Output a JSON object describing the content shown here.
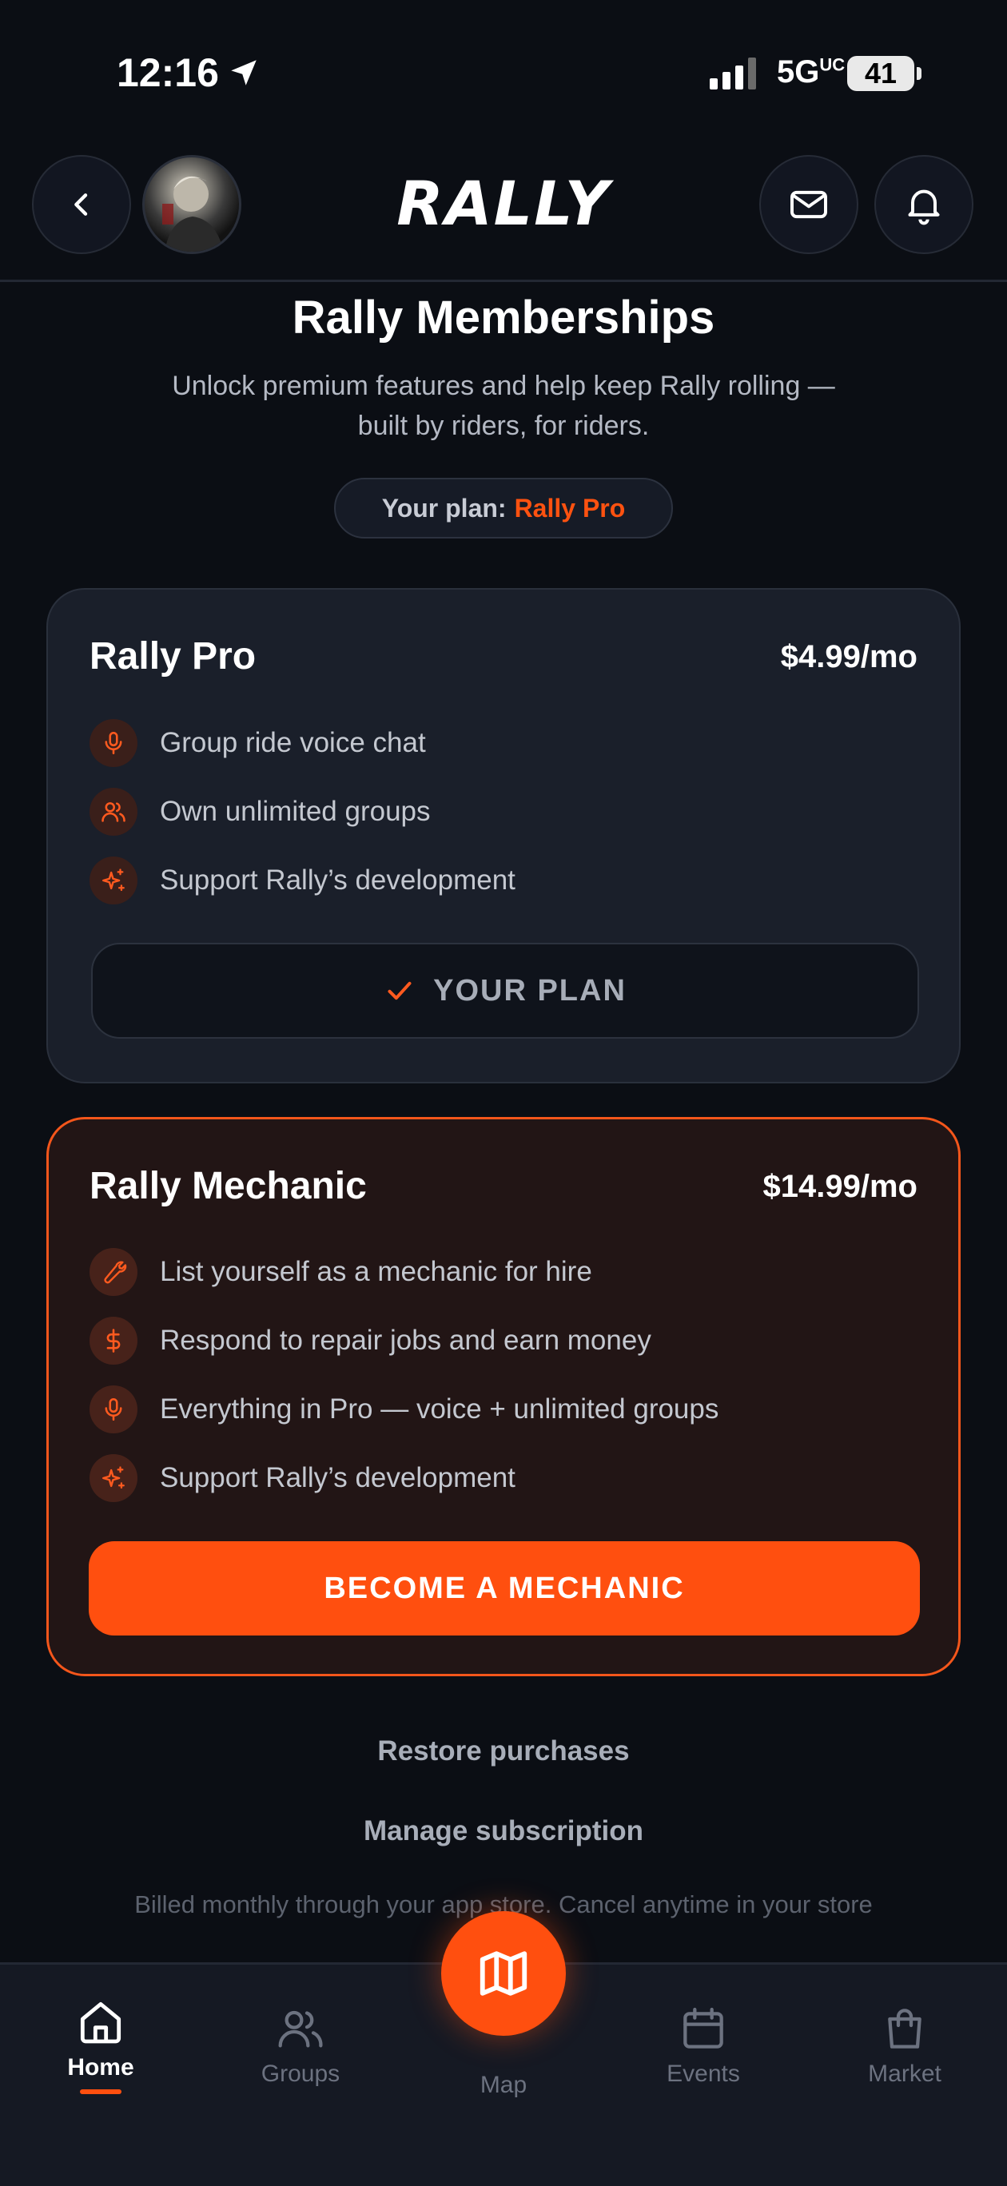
{
  "status_bar": {
    "time": "12:16",
    "network": "5G",
    "network_suffix": "UC",
    "battery": "41"
  },
  "header": {
    "logo_text": "RALLY"
  },
  "hero": {
    "title": "Rally Memberships",
    "subtitle_line1": "Unlock premium features and help keep Rally rolling —",
    "subtitle_line2": "built by riders, for riders.",
    "plan_prefix": "Your plan:",
    "plan_name": "Rally Pro"
  },
  "plans": [
    {
      "name": "Rally Pro",
      "price": "$4.99/mo",
      "features": [
        {
          "icon": "microphone-icon",
          "text": "Group ride voice chat"
        },
        {
          "icon": "users-icon",
          "text": "Own unlimited groups"
        },
        {
          "icon": "sparkles-icon",
          "text": "Support Rally’s development"
        }
      ],
      "button_label": "YOUR PLAN",
      "current": true
    },
    {
      "name": "Rally Mechanic",
      "price": "$14.99/mo",
      "features": [
        {
          "icon": "wrench-icon",
          "text": "List yourself as a mechanic for hire"
        },
        {
          "icon": "dollar-icon",
          "text": "Respond to repair jobs and earn money"
        },
        {
          "icon": "microphone-icon",
          "text": "Everything in Pro — voice + unlimited groups"
        },
        {
          "icon": "sparkles-icon",
          "text": "Support Rally’s development"
        }
      ],
      "button_label": "BECOME A MECHANIC",
      "current": false
    }
  ],
  "links": {
    "restore": "Restore purchases",
    "manage": "Manage subscription"
  },
  "fine_print": "Billed monthly through your app store. Cancel anytime in your store",
  "tabbar": {
    "home": "Home",
    "groups": "Groups",
    "map": "Map",
    "events": "Events",
    "market": "Market",
    "active": "Home"
  },
  "colors": {
    "accent": "#ff4f0f",
    "background": "#0b0e14",
    "card": "#1a1f2a",
    "card_highlight": "#221515"
  }
}
